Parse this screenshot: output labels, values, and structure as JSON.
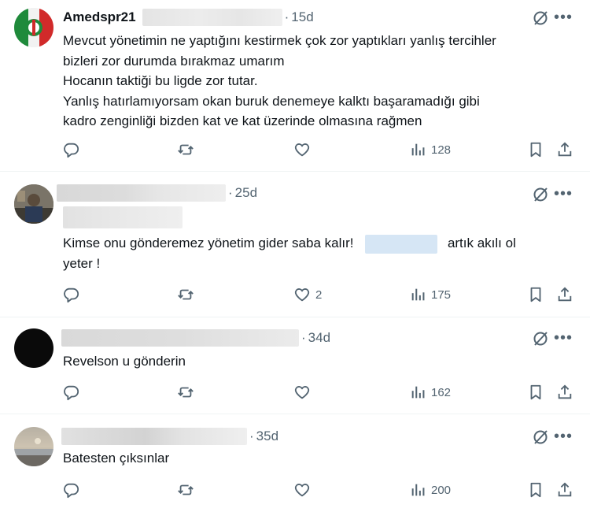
{
  "posts": [
    {
      "author": "Amedspr21",
      "time": "15d",
      "lines": [
        "Mevcut yönetimin ne yaptığını kestirmek çok zor yaptıkları yanlış tercihler",
        "bizleri zor durumda bırakmaz umarım",
        "Hocanın taktiği bu ligde zor tutar.",
        "Yanlış hatırlamıyorsam okan buruk denemeye kalktı başaramadığı gibi",
        "kadro zenginliği bizden kat ve kat üzerinde olmasına rağmen"
      ],
      "likes": "",
      "views": "128"
    },
    {
      "author": "",
      "time": "25d",
      "text_before": "Kimse onu gönderemez yönetim gider saba kalır!",
      "text_after": "artık akılı ol",
      "text_line2": "yeter !",
      "likes": "2",
      "views": "175"
    },
    {
      "author": "",
      "time": "34d",
      "lines": [
        "Revelson u gönderin"
      ],
      "likes": "",
      "views": "162"
    },
    {
      "author": "",
      "time": "35d",
      "lines": [
        "Batesten çıksınlar"
      ],
      "likes": "",
      "views": "200"
    }
  ],
  "icons": {
    "reply": "reply-icon",
    "repost": "repost-icon",
    "like": "heart-icon",
    "views": "views-icon",
    "bookmark": "bookmark-icon",
    "share": "share-icon",
    "grok": "grok-icon",
    "more": "more-icon"
  },
  "more_label": "•••"
}
